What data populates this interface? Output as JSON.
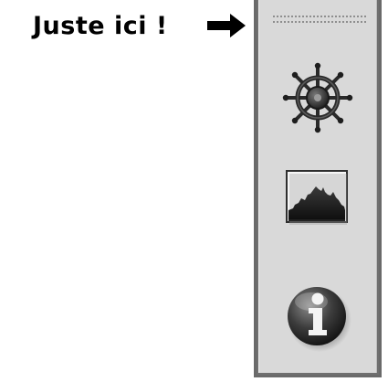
{
  "annotation": {
    "callout_text": "Juste ici !"
  },
  "icons": {
    "arrow": "right-arrow-icon",
    "grip": "grip-handle-icon",
    "navigator": "ship-wheel-icon",
    "histogram": "histogram-icon",
    "info": "info-icon"
  },
  "colors": {
    "panel_bg": "#d9d9d9",
    "panel_border": "#6a6a6a"
  }
}
